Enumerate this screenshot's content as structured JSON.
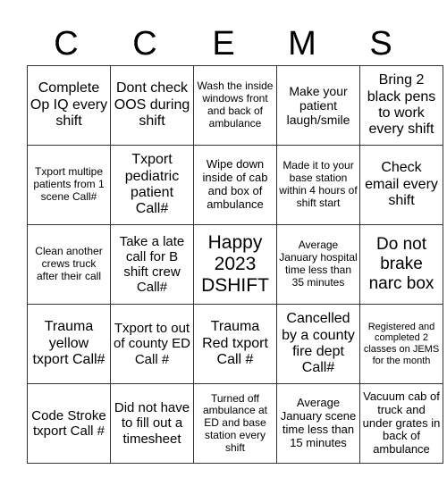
{
  "header": {
    "letters": [
      "C",
      "C",
      "E",
      "M",
      "S"
    ]
  },
  "rows": [
    [
      "Complete Op IQ every shift",
      "Dont check OOS during shift",
      "Wash the inside windows front and back of ambulance",
      "Make your patient laugh/smile",
      "Bring 2 black pens to work every shift"
    ],
    [
      "Txport multipe patients from 1 scene Call#",
      "Txport pediatric patient Call#",
      "Wipe down inside of cab and box of ambulance",
      "Made it to your base station within 4 hours of shift start",
      "Check email every shift"
    ],
    [
      "Clean another crews truck after their call",
      "Take a late call for B shift crew Call#",
      "Happy 2023 DSHIFT",
      "Average January hospital time less than 35 minutes",
      "Do not brake narc box"
    ],
    [
      "Trauma yellow txport Call#",
      "Txport to out of county ED Call #",
      "Trauma Red txport Call #",
      "Cancelled by a county fire dept Call#",
      "Registered and completed 2 classes on JEMS for the month"
    ],
    [
      "Code Stroke txport Call #",
      "Did not have to fill out a timesheet",
      "Turned off ambulance at ED and base station every shift",
      "Average January scene time less than 15 minutes",
      "Vacuum cab of truck and under grates in back of ambulance"
    ]
  ]
}
